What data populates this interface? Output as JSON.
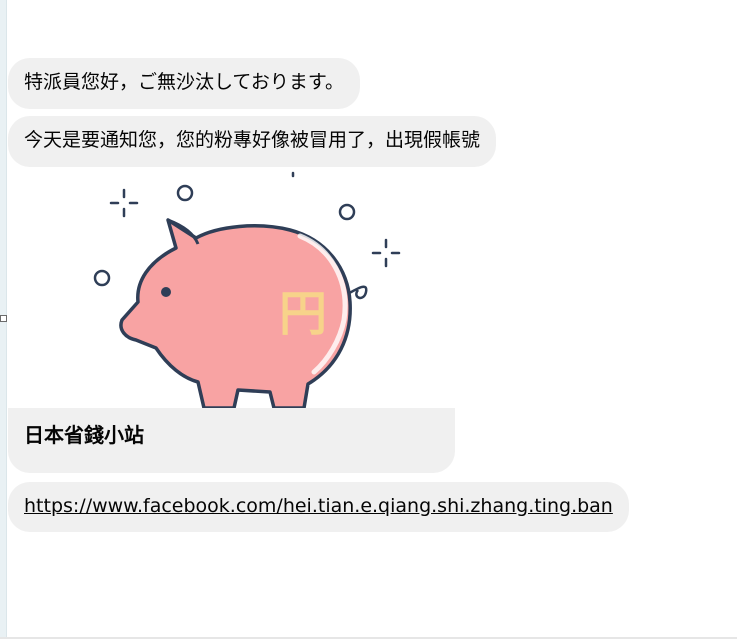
{
  "messages": {
    "msg1": "特派員您好，ご無沙汰しております。",
    "msg2": "今天是要通知您，您的粉專好像被冒用了，出現假帳號"
  },
  "card": {
    "title": "日本省錢小站",
    "image_icon": "piggy-bank-yen-icon",
    "piggy_symbol": "円",
    "colors": {
      "pig_body": "#f8a3a3",
      "pig_outline": "#2f3e57",
      "yen_mark": "#f7d38a"
    }
  },
  "link": {
    "url": "https://www.facebook.com/hei.tian.e.qiang.shi.zhang.ting.ban"
  },
  "colors": {
    "bubble_bg": "#f0f0f0",
    "text": "#050505"
  }
}
